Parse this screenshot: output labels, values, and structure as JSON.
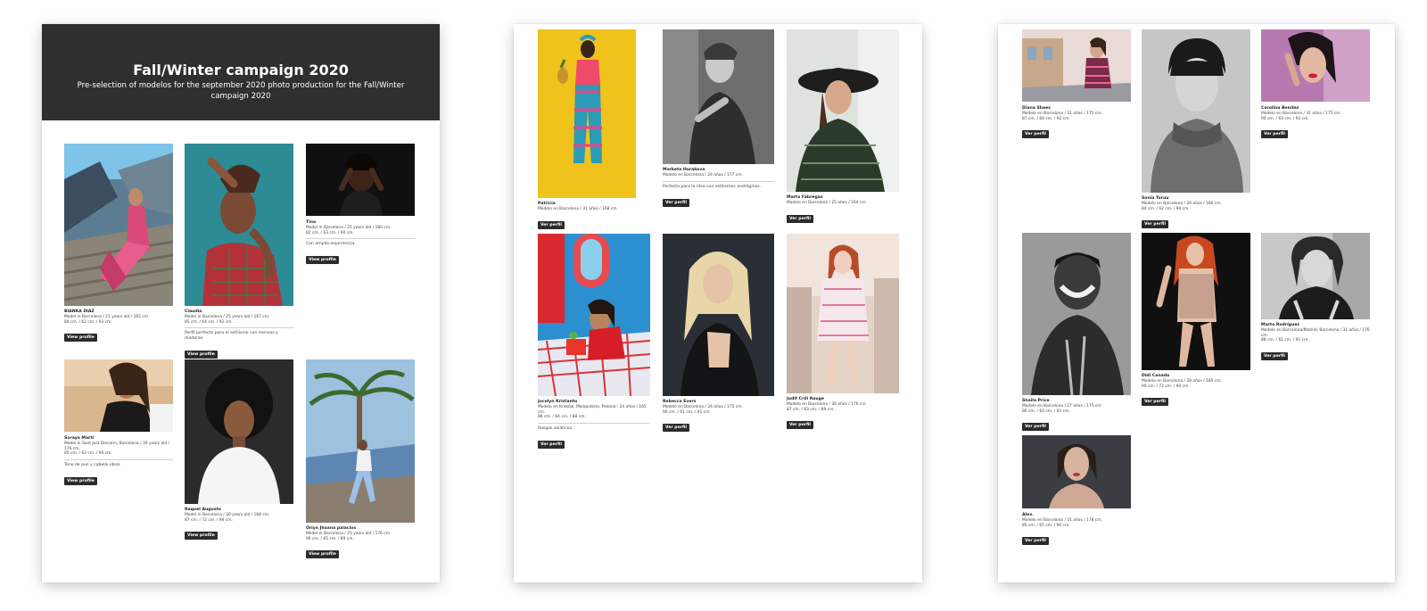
{
  "page1": {
    "title": "Fall/Winter campaign 2020",
    "subtitle": "Pre-selection of modelos for the september 2020 photo production for the Fall/Winter campaign 2020",
    "models": [
      {
        "name": "BIANKA DIAZ",
        "info": "Model in Barcelona / 21 years old / 165 cm.",
        "measures": "84 cm. / 62 cm. / 93 cm.",
        "note": "",
        "button": "View profile"
      },
      {
        "name": "Claudia",
        "info": "Model in Barcelona / 25 years old / 167 cm.",
        "measures": "85 cm. / 64 cm. / 92 cm.",
        "note": "Perfil perfecto para el estilismo con mensos y maderas.",
        "button": "View profile"
      },
      {
        "name": "Tina",
        "info": "Model in Barcelona / 25 years old / 180 cm.",
        "measures": "82 cm. / 63 cm. / 90 cm.",
        "note": "Con amplia experiencia.",
        "button": "View profile"
      },
      {
        "name": "Soraya Marti",
        "info": "Model in Sant Just Desvern, Barcelona / 30 years old / 176 cm.",
        "measures": "85 cm. / 63 cm. / 90 cm.",
        "note": "Tono de piel y cabello ideal.",
        "button": "View profile"
      },
      {
        "name": "Raquel Augusto",
        "info": "Model in Barcelona / 30 years old / 168 cm.",
        "measures": "87 cm. / 72 cm. / 98 cm.",
        "note": "",
        "button": "View profile"
      },
      {
        "name": "Oriyn Jhoana palacios",
        "info": "Model in Barcelona / 25 years old / 176 cm.",
        "measures": "90 cm. / 65 cm. / 89 cm.",
        "note": "",
        "button": "View profile"
      }
    ]
  },
  "page2": {
    "models": [
      {
        "name": "Patricia",
        "info": "Modelo en Barcelona / 31 años / 168 cm.",
        "measures": "",
        "note": "",
        "button": "Ver perfil"
      },
      {
        "name": "Marketa Horakova",
        "info": "Modelo en Barcelona / 24 años / 177 cm.",
        "measures": "",
        "note": "Perfecta para la idea con estilismos andróginos.",
        "button": "Ver perfil"
      },
      {
        "name": "Marta Fábregas",
        "info": "Modelo en Barcelona / 25 años / 164 cm.",
        "measures": "",
        "note": "",
        "button": "Ver perfil"
      },
      {
        "name": "Jocelyn Kristanto",
        "info": "Modelo en Kraków, Malopolskie, Polonia / 24 años / 165 cm.",
        "measures": "86 cm. / 64 cm. / 88 cm.",
        "note": "Rasgos asiáticos.",
        "button": "Ver perfil"
      },
      {
        "name": "Rebecca Evers",
        "info": "Modelo en Barcelona / 24 años / 175 cm.",
        "measures": "90 cm. / 61 cm. / 91 cm.",
        "note": "",
        "button": "Ver perfil"
      },
      {
        "name": "Judit Crdi Rauge",
        "info": "Modelo en Barcelona / 30 años / 176 cm.",
        "measures": "87 cm. / 63 cm. / 89 cm.",
        "note": "",
        "button": "Ver perfil"
      }
    ]
  },
  "page3": {
    "models": [
      {
        "name": "Diana Shaes",
        "info": "Modelo en Barcelona / 31 años / 175 cm.",
        "measures": "87 cm. / 64 cm. / 92 cm.",
        "note": "",
        "button": "Ver perfil"
      },
      {
        "name": "Sonia Toruu",
        "info": "Modelo en Barcelona / 29 años / 180 cm.",
        "measures": "84 cm. / 62 cm. / 90 cm.",
        "note": "",
        "button": "Ver perfil"
      },
      {
        "name": "Carolina Benítez",
        "info": "Modelo en Barcelona / 31 años / 175 cm.",
        "measures": "90 cm. / 63 cm. / 93 cm.",
        "note": "",
        "button": "Ver perfil"
      },
      {
        "name": "Sheila Price",
        "info": "Modelo en Barcelona / 27 años / 175 cm.",
        "measures": "86 cm. / 64 cm. / 91 cm.",
        "note": "",
        "button": "Ver perfil"
      },
      {
        "name": "Didi Canada",
        "info": "Modelo en Barcelona / 28 años / 185 cm.",
        "measures": "90 cm. / 72 cm. / 90 cm.",
        "note": "",
        "button": "Ver perfil"
      },
      {
        "name": "Marta Rodríguez",
        "info": "Modelo en Barcelona/Madrid, Barcelona / 31 años / 176 cm.",
        "measures": "88 cm. / 61 cm. / 91 cm.",
        "note": "",
        "button": "Ver perfil"
      },
      {
        "name": "Alex.",
        "info": "Modelo en Barcelona / 31 años / 178 cm.",
        "measures": "85 cm. / 65 cm. / 90 cm.",
        "note": "",
        "button": "Ver perfil"
      }
    ]
  }
}
